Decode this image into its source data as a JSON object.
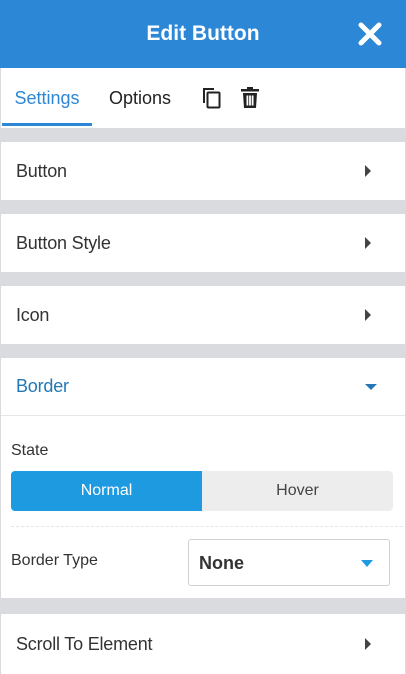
{
  "header": {
    "title": "Edit Button",
    "close_icon": "close-icon"
  },
  "tabs": {
    "settings": "Settings",
    "options": "Options",
    "copy_icon": "copy-icon",
    "trash_icon": "trash-icon"
  },
  "sections": {
    "button": "Button",
    "button_style": "Button Style",
    "icon": "Icon",
    "border": "Border",
    "scroll_to_element": "Scroll To Element"
  },
  "border": {
    "state_label": "State",
    "state_options": [
      "Normal",
      "Hover"
    ],
    "state_selected": "Normal",
    "border_type_label": "Border Type",
    "border_type_value": "None"
  },
  "colors": {
    "header_bg": "#2c87d6",
    "accent": "#2c87d6",
    "section_active": "#2378b5",
    "toggle_active": "#1e9be0",
    "divider_bg": "#d9dbdf"
  }
}
